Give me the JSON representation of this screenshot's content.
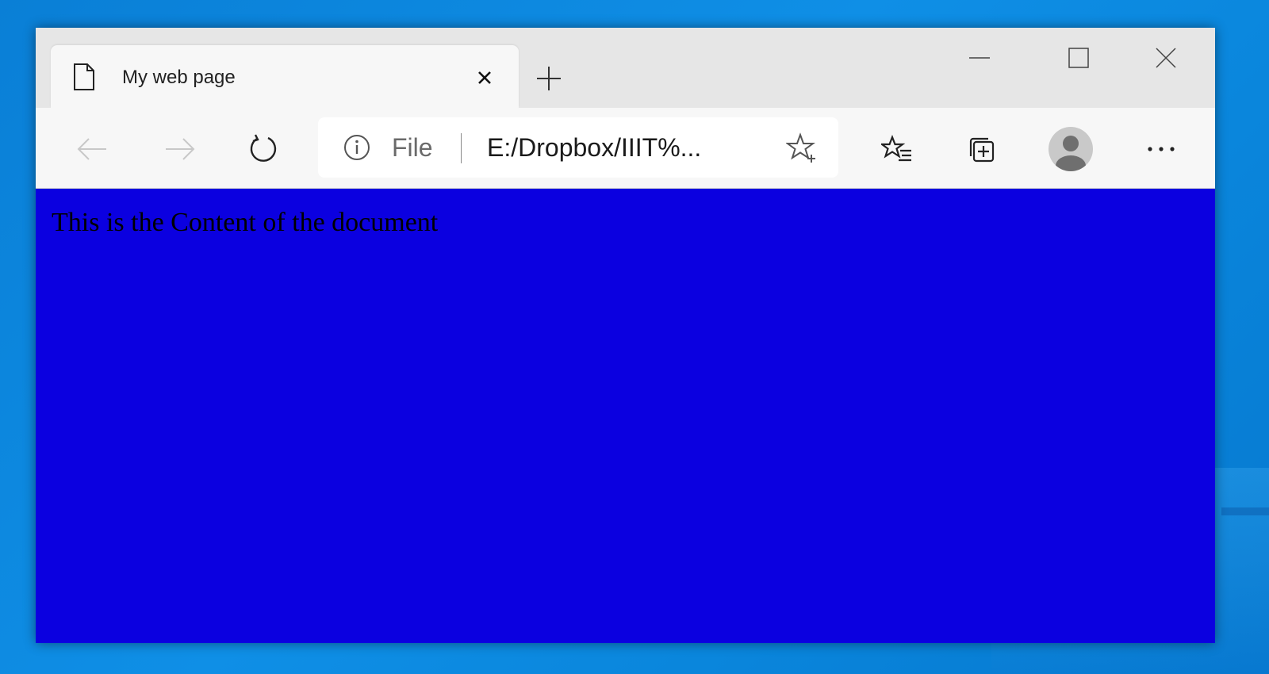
{
  "browser": {
    "tab": {
      "title": "My web page",
      "icon": "page-icon"
    },
    "window_controls": {
      "minimize_icon": "minimize-icon",
      "maximize_icon": "maximize-icon",
      "close_icon": "close-icon"
    },
    "toolbar": {
      "back_icon": "back-arrow-icon",
      "forward_icon": "forward-arrow-icon",
      "refresh_icon": "refresh-icon",
      "favorites_icon": "favorites-list-icon",
      "collections_icon": "collections-icon",
      "profile_icon": "profile-avatar-icon",
      "more_icon": "more-icon"
    },
    "address_bar": {
      "scheme_label": "File",
      "url": "E:/Dropbox/IIIT%...",
      "info_icon": "info-icon",
      "favorite_add_icon": "add-favorite-star-icon"
    }
  },
  "page": {
    "background_color": "#0b00e0",
    "content_text": "This is the Content of the document"
  },
  "colors": {
    "tabstrip": "#e6e6e6",
    "toolbar": "#f7f7f7",
    "desktop": "#0f8fe6"
  }
}
